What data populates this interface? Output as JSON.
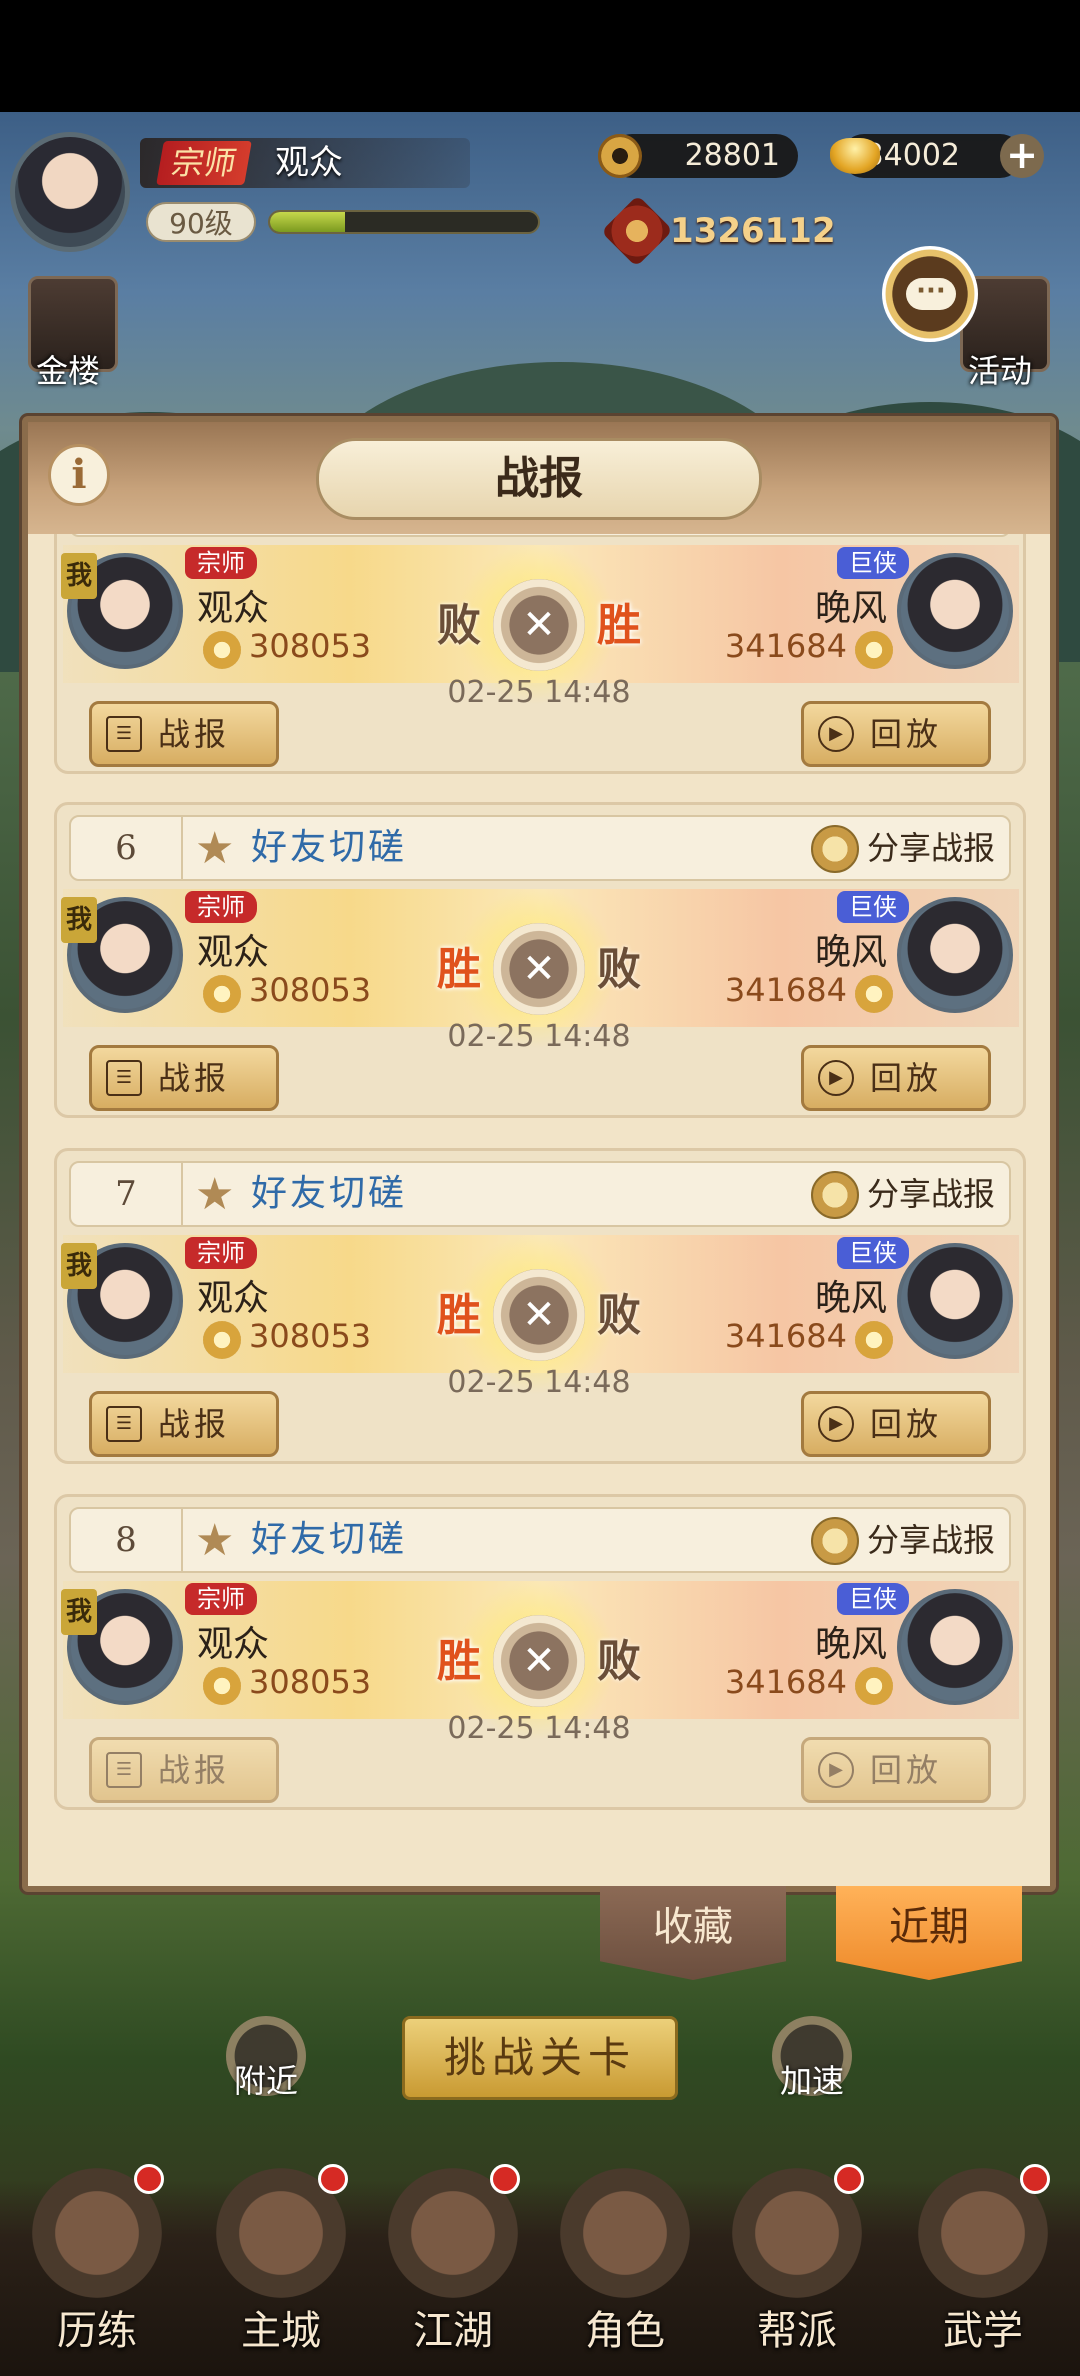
{
  "header": {
    "rank": "宗师",
    "name": "观众",
    "level": "90级",
    "exp_fraction": 0.28,
    "coins": "28801",
    "ingots": "34002",
    "power": "1326112"
  },
  "side": {
    "left_label": "金楼",
    "right_label": "活动"
  },
  "panel": {
    "title": "战报"
  },
  "reports": [
    {
      "num": "",
      "type": "",
      "share": "",
      "me": "我",
      "left_rank": "宗师",
      "left_name": "观众",
      "left_power": "308053",
      "left_result": "败",
      "right_result": "胜",
      "right_rank": "巨侠",
      "right_name": "晚风",
      "right_power": "341684",
      "date": "02-25 14:48",
      "btn_report": "战报",
      "btn_replay": "回放"
    },
    {
      "num": "6",
      "type": "好友切磋",
      "share": "分享战报",
      "me": "我",
      "left_rank": "宗师",
      "left_name": "观众",
      "left_power": "308053",
      "left_result": "胜",
      "right_result": "败",
      "right_rank": "巨侠",
      "right_name": "晚风",
      "right_power": "341684",
      "date": "02-25 14:48",
      "btn_report": "战报",
      "btn_replay": "回放"
    },
    {
      "num": "7",
      "type": "好友切磋",
      "share": "分享战报",
      "me": "我",
      "left_rank": "宗师",
      "left_name": "观众",
      "left_power": "308053",
      "left_result": "胜",
      "right_result": "败",
      "right_rank": "巨侠",
      "right_name": "晚风",
      "right_power": "341684",
      "date": "02-25 14:48",
      "btn_report": "战报",
      "btn_replay": "回放"
    },
    {
      "num": "8",
      "type": "好友切磋",
      "share": "分享战报",
      "me": "我",
      "left_rank": "宗师",
      "left_name": "观众",
      "left_power": "308053",
      "left_result": "胜",
      "right_result": "败",
      "right_rank": "巨侠",
      "right_name": "晚风",
      "right_power": "341684",
      "date": "02-25 14:48",
      "btn_report": "战报",
      "btn_replay": "回放"
    }
  ],
  "tabs": {
    "favorites": "收藏",
    "recent": "近期"
  },
  "actions": {
    "nearby": "附近",
    "challenge": "挑战关卡",
    "speedup": "加速"
  },
  "nav": [
    {
      "label": "历练"
    },
    {
      "label": "主城"
    },
    {
      "label": "江湖"
    },
    {
      "label": "角色"
    },
    {
      "label": "帮派"
    },
    {
      "label": "武学"
    }
  ],
  "colors": {
    "win": "#e0521c",
    "accent_tab": "#ee8a2a",
    "type_text": "#2f6aa8"
  }
}
